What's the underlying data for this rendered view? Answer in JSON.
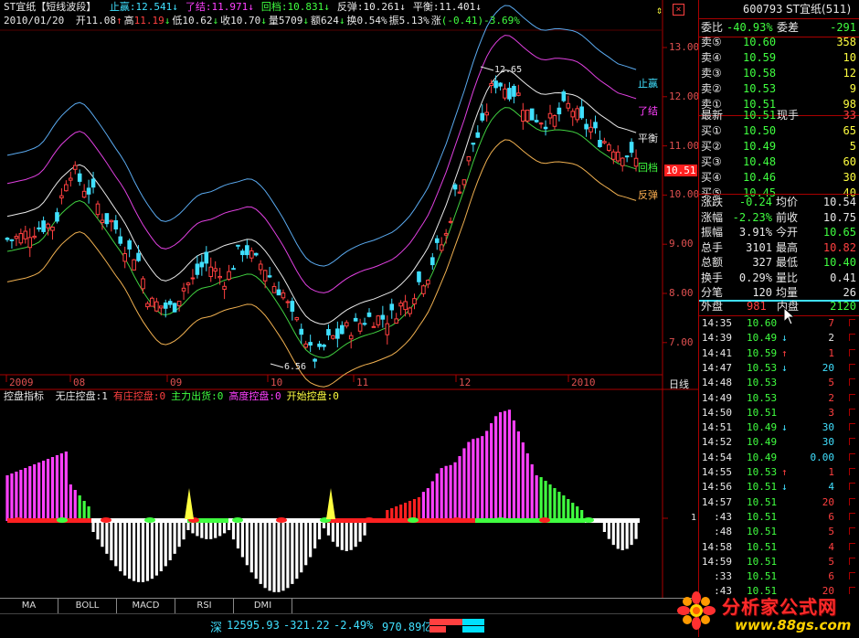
{
  "header": {
    "title": "ST宜纸【短线波段】",
    "indicators": [
      {
        "label": "止赢:",
        "value": "12.541",
        "arrow": "↓",
        "color": "#40e0ff"
      },
      {
        "label": "了结:",
        "value": "11.971",
        "arrow": "↓",
        "color": "#ff40ff"
      },
      {
        "label": "回档:",
        "value": "10.831",
        "arrow": "↓",
        "color": "#40ff40"
      },
      {
        "label": "反弹:",
        "value": "10.261",
        "arrow": "↓",
        "color": "#e8e8e8"
      },
      {
        "label": "平衡:",
        "value": "11.401",
        "arrow": "↓",
        "color": "#e8e8e8"
      }
    ],
    "date": "2010/01/20",
    "ohlc": [
      {
        "label": "开",
        "value": "11.08",
        "arrow": "↑",
        "color": "#e8e8e8"
      },
      {
        "label": "高",
        "value": "11.19",
        "arrow": "↓",
        "color": "#ff4040"
      },
      {
        "label": "低",
        "value": "10.62",
        "arrow": "↓",
        "color": "#e8e8e8"
      },
      {
        "label": "收",
        "value": "10.70",
        "arrow": "↓",
        "color": "#e8e8e8"
      },
      {
        "label": "量",
        "value": "5709",
        "arrow": "↓",
        "color": "#e8e8e8"
      },
      {
        "label": "额",
        "value": "624",
        "arrow": "↓",
        "color": "#e8e8e8"
      },
      {
        "label": "换",
        "value": "0.54%",
        "arrow": "",
        "color": "#e8e8e8"
      },
      {
        "label": "振",
        "value": "5.13%",
        "arrow": "",
        "color": "#e8e8e8"
      },
      {
        "label": "涨",
        "value": "(-0.41)-3.69%",
        "arrow": "",
        "color": "#40ff40"
      }
    ]
  },
  "price_axis": {
    "labels": [
      "13.00",
      "12.00",
      "11.00",
      "10.00",
      "9.00",
      "8.00",
      "7.00"
    ],
    "values": [
      13,
      12,
      11,
      10,
      9,
      8,
      7
    ],
    "current": "10.51"
  },
  "line_labels": {
    "zhiying": "止赢",
    "liaojie": "了结",
    "pingheng": "平衡",
    "huidang": "回档",
    "fantan": "反弹",
    "high_mark": "12.65",
    "low_mark": "6.56"
  },
  "time_axis": {
    "labels": [
      "2009",
      "08",
      "09",
      "10",
      "11",
      "12",
      "2010"
    ],
    "period": "日线"
  },
  "sub_header": {
    "name": "控盘指标",
    "items": [
      {
        "label": "无庄控盘:",
        "value": "1",
        "color": "#e8e8e8"
      },
      {
        "label": "有庄控盘:",
        "value": "0",
        "color": "#ff4040"
      },
      {
        "label": "主力出货:",
        "value": "0",
        "color": "#40ff40"
      },
      {
        "label": "高度控盘:",
        "value": "0",
        "color": "#ff40ff"
      },
      {
        "label": "开始控盘:",
        "value": "0",
        "color": "#ffff40"
      }
    ],
    "axis_label": "1"
  },
  "tabs": [
    "MA",
    "BOLL",
    "MACD",
    "RSI",
    "DMI"
  ],
  "status": {
    "market": "深",
    "index": "12595.93",
    "change": "-321.22",
    "pct": "-2.49%",
    "amount": "970.89亿"
  },
  "quote": {
    "code": "600793",
    "name": "ST宜纸(511)",
    "weibi_label": "委比",
    "weibi": "-40.93%",
    "weicha_label": "委差",
    "weicha": "-291",
    "asks": [
      {
        "label": "卖⑤",
        "price": "10.60",
        "vol": "358"
      },
      {
        "label": "卖④",
        "price": "10.59",
        "vol": "10"
      },
      {
        "label": "卖③",
        "price": "10.58",
        "vol": "12"
      },
      {
        "label": "卖②",
        "price": "10.53",
        "vol": "9"
      },
      {
        "label": "卖①",
        "price": "10.51",
        "vol": "98"
      }
    ],
    "latest_label": "最新",
    "latest": "10.51",
    "xianshou_label": "现手",
    "xianshou": "33",
    "bids": [
      {
        "label": "买①",
        "price": "10.50",
        "vol": "65"
      },
      {
        "label": "买②",
        "price": "10.49",
        "vol": "5"
      },
      {
        "label": "买③",
        "price": "10.48",
        "vol": "60"
      },
      {
        "label": "买④",
        "price": "10.46",
        "vol": "30"
      },
      {
        "label": "买⑤",
        "price": "10.45",
        "vol": "40"
      }
    ],
    "stats": [
      {
        "l1": "涨跌",
        "v1": "-0.24",
        "c1": "#40ff40",
        "l2": "均价",
        "v2": "10.54",
        "c2": "#e8e8e8"
      },
      {
        "l1": "涨幅",
        "v1": "-2.23%",
        "c1": "#40ff40",
        "l2": "前收",
        "v2": "10.75",
        "c2": "#e8e8e8"
      },
      {
        "l1": "振幅",
        "v1": "3.91%",
        "c1": "#e8e8e8",
        "l2": "今开",
        "v2": "10.65",
        "c2": "#40ff40"
      },
      {
        "l1": "总手",
        "v1": "3101",
        "c1": "#e8e8e8",
        "l2": "最高",
        "v2": "10.82",
        "c2": "#ff4040"
      },
      {
        "l1": "总额",
        "v1": "327",
        "c1": "#e8e8e8",
        "l2": "最低",
        "v2": "10.40",
        "c2": "#40ff40"
      },
      {
        "l1": "换手",
        "v1": "0.29%",
        "c1": "#e8e8e8",
        "l2": "量比",
        "v2": "0.41",
        "c2": "#e8e8e8"
      },
      {
        "l1": "分笔",
        "v1": "120",
        "c1": "#e8e8e8",
        "l2": "均量",
        "v2": "26",
        "c2": "#e8e8e8"
      }
    ],
    "waipan_label": "外盘",
    "waipan": "981",
    "neipan_label": "内盘",
    "neipan": "2120",
    "ticks": [
      {
        "time": "14:35",
        "price": "10.60",
        "arrow": "",
        "vol": "7",
        "vc": "#ff4040"
      },
      {
        "time": "14:39",
        "price": "10.49",
        "arrow": "↓",
        "vol": "2",
        "vc": "#e8e8e8"
      },
      {
        "time": "14:41",
        "price": "10.59",
        "arrow": "↑",
        "vol": "1",
        "vc": "#ff4040"
      },
      {
        "time": "14:47",
        "price": "10.53",
        "arrow": "↓",
        "vol": "20",
        "vc": "#40e0ff"
      },
      {
        "time": "14:48",
        "price": "10.53",
        "arrow": "",
        "vol": "5",
        "vc": "#ff4040"
      },
      {
        "time": "14:49",
        "price": "10.53",
        "arrow": "",
        "vol": "2",
        "vc": "#ff4040"
      },
      {
        "time": "14:50",
        "price": "10.51",
        "arrow": "",
        "vol": "3",
        "vc": "#ff4040"
      },
      {
        "time": "14:51",
        "price": "10.49",
        "arrow": "↓",
        "vol": "30",
        "vc": "#40e0ff"
      },
      {
        "time": "14:52",
        "price": "10.49",
        "arrow": "",
        "vol": "30",
        "vc": "#40e0ff"
      },
      {
        "time": "14:54",
        "price": "10.49",
        "arrow": "",
        "vol": "0.00",
        "vc": "#40e0ff"
      },
      {
        "time": "14:55",
        "price": "10.53",
        "arrow": "↑",
        "vol": "1",
        "vc": "#ff4040"
      },
      {
        "time": "14:56",
        "price": "10.51",
        "arrow": "↓",
        "vol": "4",
        "vc": "#40e0ff"
      },
      {
        "time": "14:57",
        "price": "10.51",
        "arrow": "",
        "vol": "20",
        "vc": "#ff4040"
      },
      {
        "time": ":43",
        "price": "10.51",
        "arrow": "",
        "vol": "6",
        "vc": "#ff4040"
      },
      {
        "time": ":48",
        "price": "10.51",
        "arrow": "",
        "vol": "5",
        "vc": "#ff4040"
      },
      {
        "time": "14:58",
        "price": "10.51",
        "arrow": "",
        "vol": "4",
        "vc": "#ff4040"
      },
      {
        "time": "14:59",
        "price": "10.51",
        "arrow": "",
        "vol": "5",
        "vc": "#ff4040"
      },
      {
        "time": ":33",
        "price": "10.51",
        "arrow": "",
        "vol": "6",
        "vc": "#ff4040"
      },
      {
        "time": ":43",
        "price": "10.51",
        "arrow": "",
        "vol": "20",
        "vc": "#ff4040"
      }
    ]
  },
  "logo": {
    "text": "分析家公式网",
    "url": "www.88gs.com"
  }
}
